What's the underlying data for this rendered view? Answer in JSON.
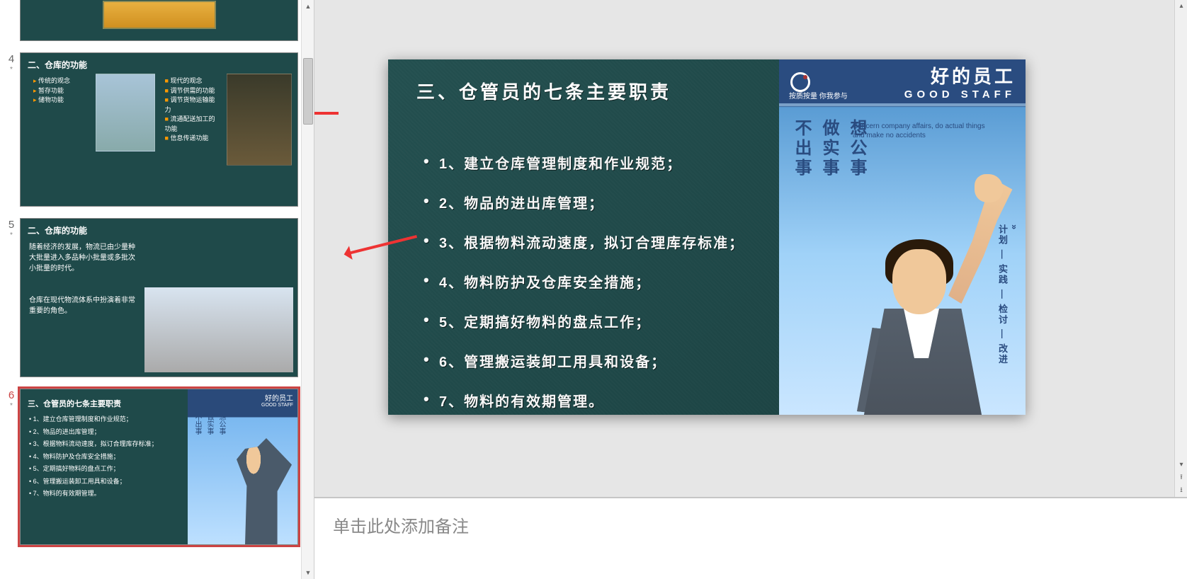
{
  "thumbs": {
    "s4": {
      "num": "4",
      "title": "二、仓库的功能",
      "col1": [
        "传统的观念",
        "暂存功能",
        "储物功能"
      ],
      "col2": [
        "现代的观念",
        "调节供需的功能",
        "调节货物运输能力",
        "流通配送加工的功能",
        "信息传递功能"
      ]
    },
    "s5": {
      "num": "5",
      "title": "二、仓库的功能",
      "text1": "随着经济的发展，物流已由少量种大批量进入多品种小批量或多批次小批量的时代。",
      "text2": "仓库在现代物流体系中扮演着非常重要的角色。"
    },
    "s6": {
      "num": "6",
      "title": "三、仓管员的七条主要职责",
      "items": [
        "1、建立仓库管理制度和作业规范；",
        "2、物品的进出库管理；",
        "3、根据物料流动速度，拟订合理库存标准；",
        "4、物料防护及仓库安全措施；",
        "5、定期搞好物料的盘点工作；",
        "6、管理搬运装卸工用具和设备；",
        "7、物料的有效期管理。"
      ],
      "poster": {
        "big": "好的员工",
        "small": "GOOD STAFF",
        "v1": "不出事",
        "v2": "做实事",
        "v3": "想公事"
      }
    }
  },
  "slide": {
    "title": "三、仓管员的七条主要职责",
    "items": [
      "1、建立仓库管理制度和作业规范；",
      "2、物品的进出库管理；",
      "3、根据物料流动速度，拟订合理库存标准；",
      "4、物料防护及仓库安全措施；",
      "5、定期搞好物料的盘点工作；",
      "6、管理搬运装卸工用具和设备；",
      "7、物料的有效期管理。"
    ],
    "poster": {
      "slogan": "按质按量 你我参与",
      "big": "好的员工",
      "small": "GOOD  STAFF",
      "v1": "不出事",
      "v2": "做实事",
      "v3": "想公事",
      "eng1": "Concern company affairs, do actual things",
      "eng2": "and make no accidents",
      "rightv": "计划 — 实践 — 检讨 — 改进"
    }
  },
  "notes": {
    "placeholder": "单击此处添加备注"
  }
}
